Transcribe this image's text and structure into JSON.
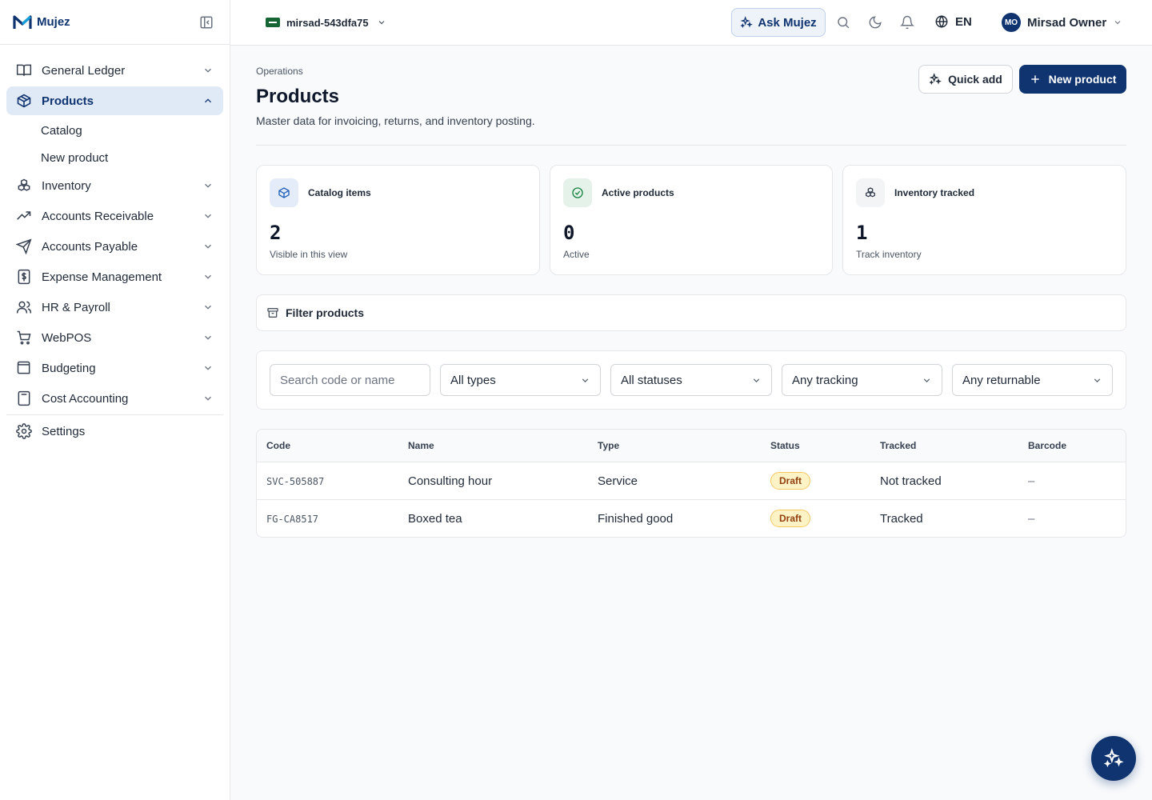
{
  "brand": {
    "name_a": "Mujez",
    "accent": "#0f3470"
  },
  "sidebar": {
    "items": [
      {
        "label": "General Ledger",
        "icon": "book-icon"
      },
      {
        "label": "Products",
        "icon": "box-icon",
        "active": true,
        "subitems": [
          "Catalog",
          "New product"
        ]
      },
      {
        "label": "Inventory",
        "icon": "boxes-icon"
      },
      {
        "label": "Accounts Receivable",
        "icon": "trend-up-icon"
      },
      {
        "label": "Accounts Payable",
        "icon": "send-icon"
      },
      {
        "label": "Expense Management",
        "icon": "receipt-icon"
      },
      {
        "label": "HR & Payroll",
        "icon": "users-icon"
      },
      {
        "label": "WebPOS",
        "icon": "cart-icon"
      },
      {
        "label": "Budgeting",
        "icon": "wallet-icon"
      },
      {
        "label": "Cost Accounting",
        "icon": "calculator-icon"
      }
    ],
    "settings": "Settings"
  },
  "topbar": {
    "tenant": "mirsad-543dfa75",
    "ask": "Ask Mujez",
    "language": "EN",
    "user_initials": "MO",
    "user_name": "Mirsad Owner"
  },
  "page": {
    "breadcrumb": "Operations",
    "title": "Products",
    "subtitle": "Master data for invoicing, returns, and inventory posting.",
    "quick_add": "Quick add",
    "new_product": "New product"
  },
  "stats": [
    {
      "label": "Catalog items",
      "value": "2",
      "hint": "Visible in this view",
      "icon": "box-icon"
    },
    {
      "label": "Active products",
      "value": "0",
      "hint": "Active",
      "icon": "check-circle-icon"
    },
    {
      "label": "Inventory tracked",
      "value": "1",
      "hint": "Track inventory",
      "icon": "boxes-icon"
    }
  ],
  "filters": {
    "toggle_label": "Filter products",
    "search_placeholder": "Search code or name",
    "type": "All types",
    "status": "All statuses",
    "tracking": "Any tracking",
    "returnable": "Any returnable"
  },
  "table": {
    "headers": [
      "Code",
      "Name",
      "Type",
      "Status",
      "Tracked",
      "Barcode"
    ],
    "rows": [
      {
        "code": "SVC-505887",
        "name": "Consulting hour",
        "type": "Service",
        "status": "Draft",
        "tracked": "Not tracked",
        "barcode": "–"
      },
      {
        "code": "FG-CA8517",
        "name": "Boxed tea",
        "type": "Finished good",
        "status": "Draft",
        "tracked": "Tracked",
        "barcode": "–"
      }
    ]
  }
}
